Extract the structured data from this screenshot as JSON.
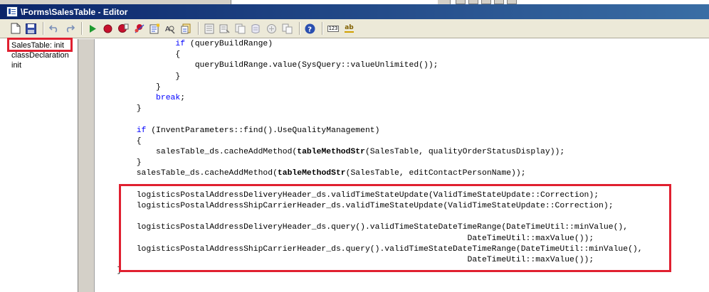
{
  "window": {
    "title": "\\Forms\\SalesTable - Editor"
  },
  "toolbar": {
    "buttons": [
      "new-icon",
      "save-icon",
      "undo-icon",
      "redo-icon",
      "run-icon",
      "breakpoint-icon",
      "toggle-breakpoint-icon",
      "remove-breakpoints-icon",
      "compile-icon",
      "lookup-icon",
      "properties-icon",
      "list-icon",
      "lookup-label-icon",
      "source-control-icon",
      "script-icon",
      "scripts-icon",
      "help-icon",
      "label-icon",
      "abc-icon"
    ],
    "label_button_text": "123",
    "abc_button_text": "ab"
  },
  "methods": {
    "items": [
      "SalesTable: init",
      "classDeclaration",
      "init"
    ],
    "selected_index": 0
  },
  "code": {
    "lines": [
      {
        "indent": "                ",
        "segments": [
          {
            "t": "if",
            "k": "kw"
          },
          {
            "t": " (queryBuildRange)"
          }
        ]
      },
      {
        "indent": "                ",
        "segments": [
          {
            "t": "{"
          }
        ]
      },
      {
        "indent": "                    ",
        "segments": [
          {
            "t": "queryBuildRange.value(SysQuery::valueUnlimited());"
          }
        ]
      },
      {
        "indent": "                ",
        "segments": [
          {
            "t": "}"
          }
        ]
      },
      {
        "indent": "            ",
        "segments": [
          {
            "t": "}"
          }
        ]
      },
      {
        "indent": "            ",
        "segments": [
          {
            "t": "break",
            "k": "kw"
          },
          {
            "t": ";"
          }
        ]
      },
      {
        "indent": "        ",
        "segments": [
          {
            "t": "}"
          }
        ]
      },
      {
        "indent": "",
        "segments": []
      },
      {
        "indent": "        ",
        "segments": [
          {
            "t": "if",
            "k": "kw"
          },
          {
            "t": " (InventParameters::find().UseQualityManagement)"
          }
        ]
      },
      {
        "indent": "        ",
        "segments": [
          {
            "t": "{"
          }
        ]
      },
      {
        "indent": "            ",
        "segments": [
          {
            "t": "salesTable_ds.cacheAddMethod("
          },
          {
            "t": "tableMethodStr",
            "k": "bold"
          },
          {
            "t": "(SalesTable, qualityOrderStatusDisplay));"
          }
        ]
      },
      {
        "indent": "        ",
        "segments": [
          {
            "t": "}"
          }
        ]
      },
      {
        "indent": "        ",
        "segments": [
          {
            "t": "salesTable_ds.cacheAddMethod("
          },
          {
            "t": "tableMethodStr",
            "k": "bold"
          },
          {
            "t": "(SalesTable, editContactPersonName));"
          }
        ]
      },
      {
        "indent": "",
        "segments": []
      },
      {
        "indent": "        ",
        "segments": [
          {
            "t": "logisticsPostalAddressDeliveryHeader_ds.validTimeStateUpdate(ValidTimeStateUpdate::Correction);"
          }
        ]
      },
      {
        "indent": "        ",
        "segments": [
          {
            "t": "logisticsPostalAddressShipCarrierHeader_ds.validTimeStateUpdate(ValidTimeStateUpdate::Correction);"
          }
        ]
      },
      {
        "indent": "",
        "segments": []
      },
      {
        "indent": "        ",
        "segments": [
          {
            "t": "logisticsPostalAddressDeliveryHeader_ds.query().validTimeStateDateTimeRange(DateTimeUtil::minValue(),"
          }
        ]
      },
      {
        "indent": "                                                                            ",
        "segments": [
          {
            "t": "DateTimeUtil::maxValue());"
          }
        ]
      },
      {
        "indent": "        ",
        "segments": [
          {
            "t": "logisticsPostalAddressShipCarrierHeader_ds.query().validTimeStateDateTimeRange(DateTimeUtil::minValue(),"
          }
        ]
      },
      {
        "indent": "                                                                            ",
        "segments": [
          {
            "t": "DateTimeUtil::maxValue());"
          }
        ]
      },
      {
        "indent": "    ",
        "segments": [
          {
            "t": "}"
          }
        ]
      }
    ]
  }
}
